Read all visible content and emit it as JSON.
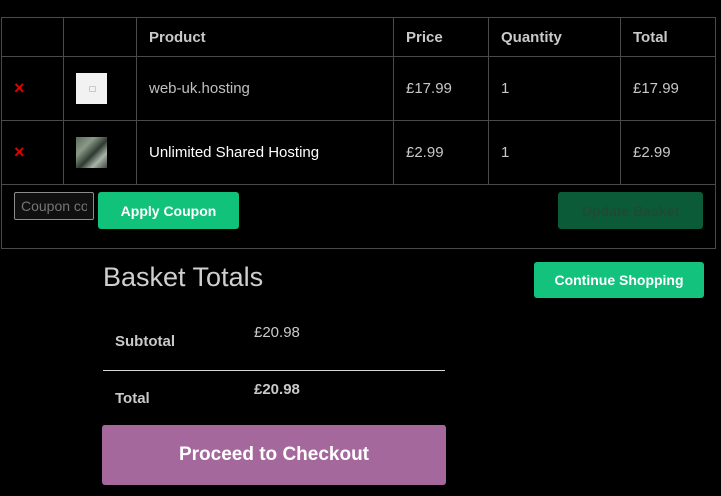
{
  "cart": {
    "headers": [
      "",
      "",
      "Product",
      "Price",
      "Quantity",
      "Total"
    ],
    "remove_icon": "×",
    "rows": [
      {
        "product": "web-uk.hosting",
        "price": "£17.99",
        "quantity": "1",
        "total": "£17.99"
      },
      {
        "product": "Unlimited Shared Hosting",
        "price": "£2.99",
        "quantity": "1",
        "total": "£2.99"
      }
    ],
    "coupon_placeholder": "Coupon code",
    "apply_label": "Apply Coupon",
    "update_label": "Update Basket"
  },
  "totals": {
    "title": "Basket Totals",
    "continue_label": "Continue Shopping",
    "subtotal_label": "Subtotal",
    "subtotal_value": "£20.98",
    "total_label": "Total",
    "total_value": "£20.98",
    "checkout_label": "Proceed to Checkout"
  },
  "colors": {
    "accent_green": "#10c27a",
    "checkout_purple": "#a4689d",
    "remove_red": "#e00000"
  }
}
